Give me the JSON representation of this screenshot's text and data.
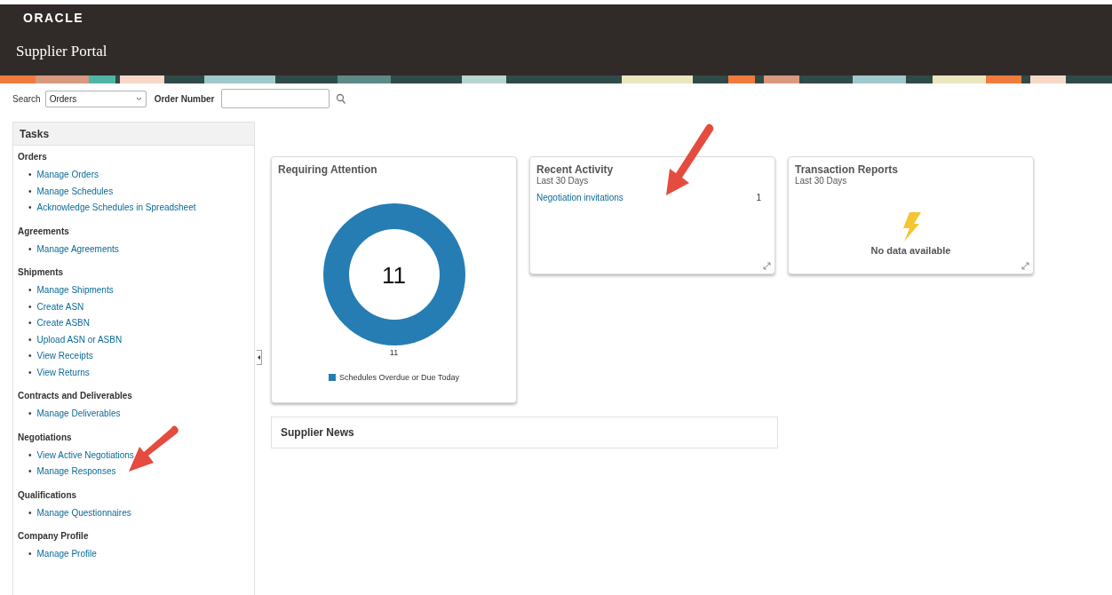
{
  "header": {
    "logo": "ORACLE",
    "title": "Supplier Portal"
  },
  "search_bar": {
    "label": "Search",
    "select_value": "Orders",
    "field_label": "Order Number"
  },
  "tasks": {
    "title": "Tasks",
    "bullet": "•",
    "groups": [
      {
        "heading": "Orders",
        "items": [
          "Manage Orders",
          "Manage Schedules",
          "Acknowledge Schedules in Spreadsheet"
        ]
      },
      {
        "heading": "Agreements",
        "items": [
          "Manage Agreements"
        ]
      },
      {
        "heading": "Shipments",
        "items": [
          "Manage Shipments",
          "Create ASN",
          "Create ASBN",
          "Upload ASN or ASBN",
          "View Receipts",
          "View Returns"
        ]
      },
      {
        "heading": "Contracts and Deliverables",
        "items": [
          "Manage Deliverables"
        ]
      },
      {
        "heading": "Negotiations",
        "items": [
          "View Active Negotiations",
          "Manage Responses"
        ]
      },
      {
        "heading": "Qualifications",
        "items": [
          "Manage Questionnaires"
        ]
      },
      {
        "heading": "Company Profile",
        "items": [
          "Manage Profile"
        ]
      }
    ]
  },
  "requiring_attention": {
    "title": "Requiring Attention",
    "total": "11",
    "donut_label": "11",
    "legend": [
      {
        "label": "Schedules Overdue or Due Today",
        "color": "#267db3"
      }
    ]
  },
  "recent_activity": {
    "title": "Recent Activity",
    "subtitle": "Last 30 Days",
    "rows": [
      {
        "label": "Negotiation invitations",
        "count": "1"
      }
    ]
  },
  "transaction_reports": {
    "title": "Transaction Reports",
    "subtitle": "Last 30 Days",
    "message": "No data available"
  },
  "supplier_news": {
    "title": "Supplier News"
  }
}
